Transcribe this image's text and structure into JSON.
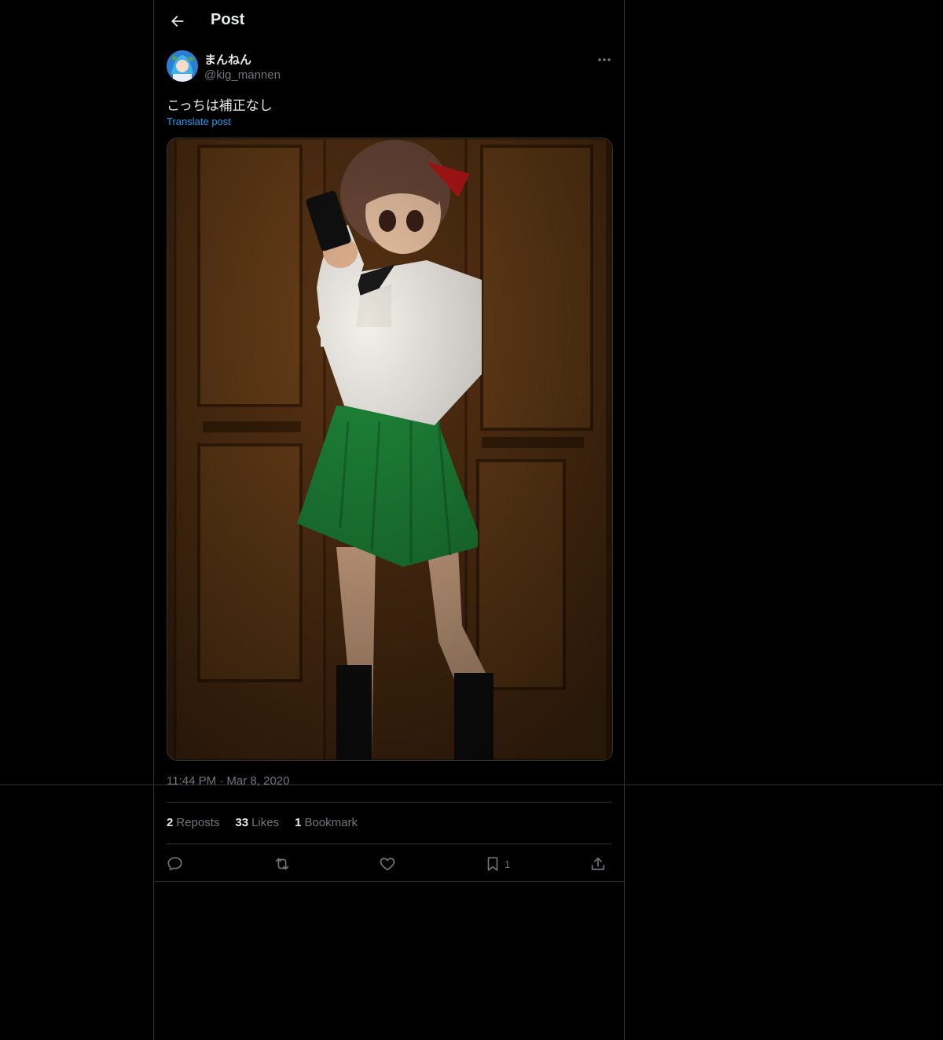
{
  "header": {
    "title": "Post",
    "back_icon": "arrow-left-icon"
  },
  "author": {
    "name": "まんねん",
    "handle": "@kig_mannen"
  },
  "post": {
    "text": "こっちは補正なし",
    "translate_label": "Translate post",
    "timestamp": "11:44 PM · Mar 8, 2020"
  },
  "stats": [
    {
      "count": "2",
      "label": "Reposts"
    },
    {
      "count": "33",
      "label": "Likes"
    },
    {
      "count": "1",
      "label": "Bookmark"
    }
  ],
  "actions": {
    "reply_icon": "reply-icon",
    "repost_icon": "repost-icon",
    "like_icon": "heart-icon",
    "bookmark_icon": "bookmark-icon",
    "bookmark_count": "1",
    "share_icon": "share-icon"
  },
  "colors": {
    "background": "#000000",
    "text": "#e7e9ea",
    "muted": "#71767b",
    "accent": "#1d9bf0",
    "border": "#2f3336"
  }
}
